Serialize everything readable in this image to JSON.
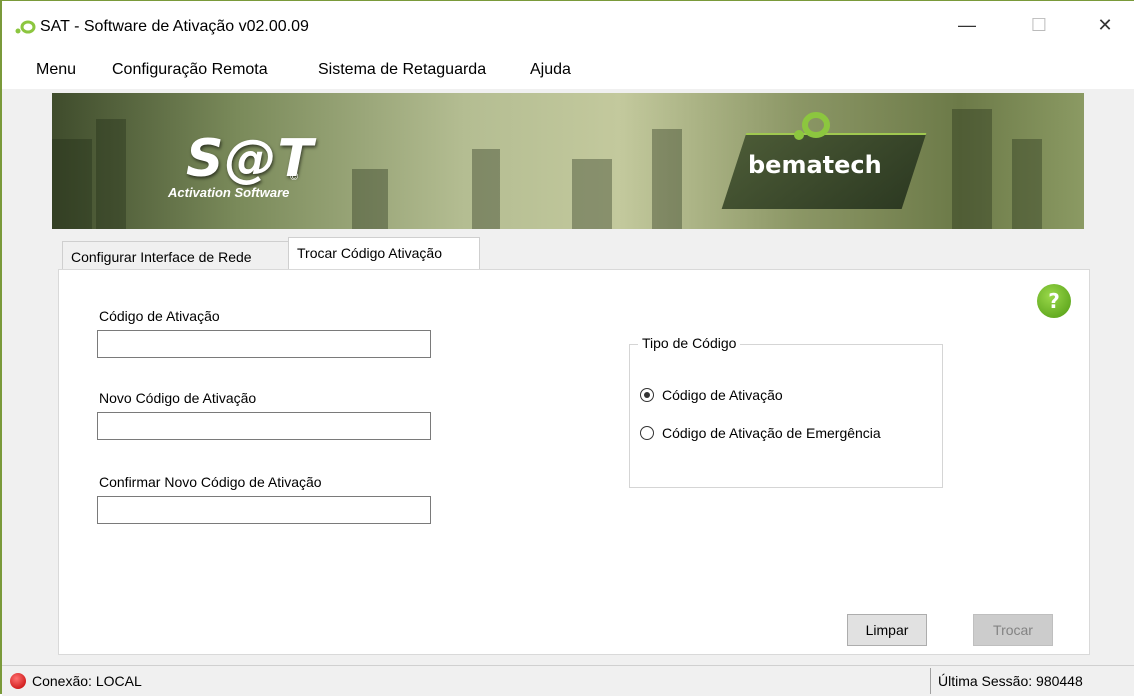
{
  "window": {
    "title": "SAT - Software de Ativação v02.00.09",
    "minimize": "—",
    "maximize": "☐",
    "close": "✕"
  },
  "menu": {
    "items": [
      {
        "label": "Menu"
      },
      {
        "label": "Configuração Remota"
      },
      {
        "label": "Sistema de Retaguarda"
      },
      {
        "label": "Ajuda"
      }
    ]
  },
  "banner": {
    "sat_logo": "S@T",
    "sat_subtitle": "Activation Software",
    "copyright": "©",
    "brand": "bematech"
  },
  "tabs": [
    {
      "label": "Configurar Interface de Rede",
      "active": false
    },
    {
      "label": "Trocar Código Ativação",
      "active": true
    }
  ],
  "form": {
    "codigo_label": "Código de Ativação",
    "codigo_value": "",
    "novo_label": "Novo Código de Ativação",
    "novo_value": "",
    "confirmar_label": "Confirmar Novo Código de Ativação",
    "confirmar_value": "",
    "help": "?"
  },
  "tipo": {
    "title": "Tipo de Código",
    "options": [
      {
        "label": "Código de Ativação",
        "selected": true
      },
      {
        "label": "Código de Ativação de Emergência",
        "selected": false
      }
    ]
  },
  "buttons": {
    "limpar": "Limpar",
    "trocar": "Trocar"
  },
  "status": {
    "connection": "Conexão: LOCAL",
    "last_session": "Última Sessão: 980448",
    "connection_color": "#d00000"
  },
  "colors": {
    "accent": "#7ab800"
  }
}
